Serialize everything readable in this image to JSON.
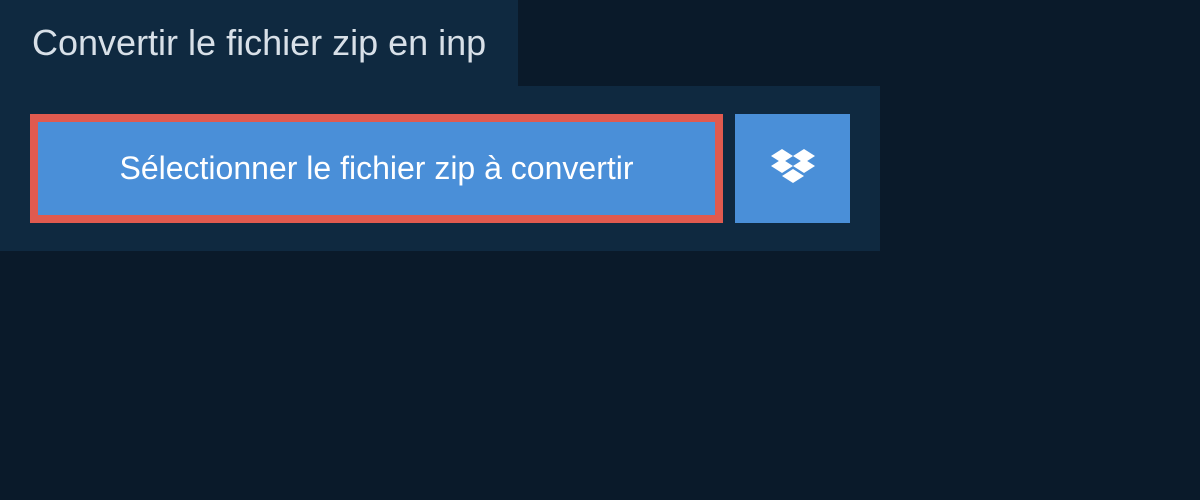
{
  "header": {
    "title": "Convertir le fichier zip en inp"
  },
  "actions": {
    "select_file_label": "Sélectionner le fichier zip à convertir",
    "dropbox_icon": "dropbox"
  },
  "colors": {
    "background": "#0a1a2a",
    "panel": "#0f2940",
    "button": "#4a8fd8",
    "highlight_border": "#e05a4f",
    "text_light": "#d8e0e8",
    "text_white": "#ffffff"
  }
}
